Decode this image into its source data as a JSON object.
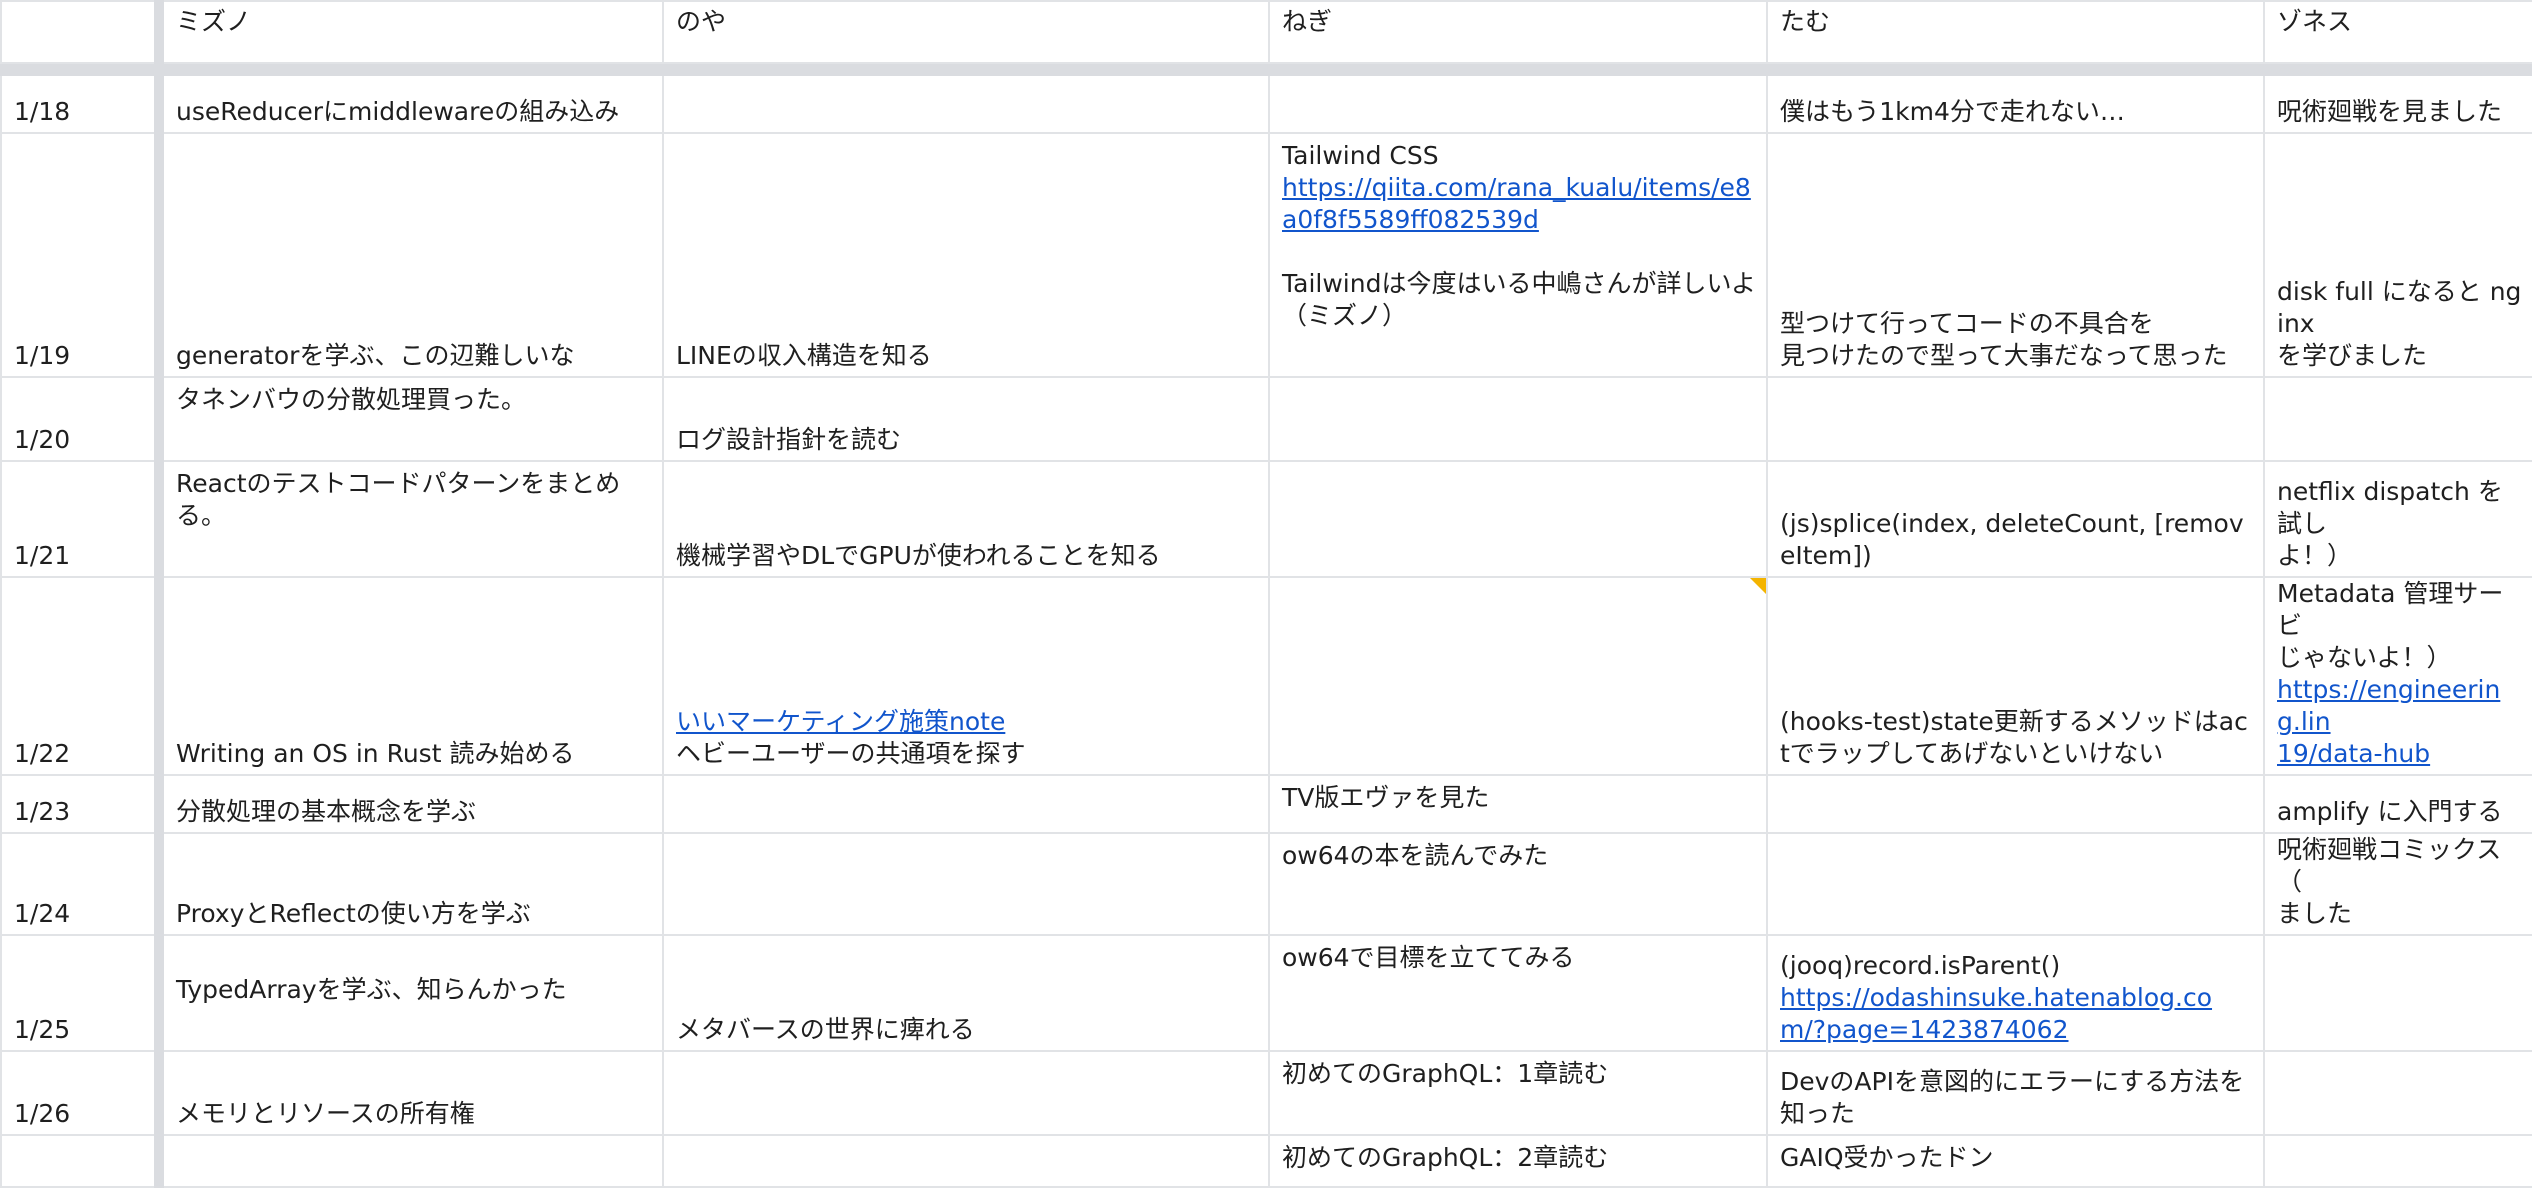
{
  "headers": [
    "",
    "ミズノ",
    "のや",
    "ねぎ",
    "たむ",
    "ゾネス"
  ],
  "rows": [
    {
      "date": "1/18",
      "cells": [
        {
          "lines": [
            {
              "t": "useReducerにmiddlewareの組み込み"
            }
          ]
        },
        {
          "lines": []
        },
        {
          "lines": []
        },
        {
          "lines": [
            {
              "t": "僕はもう1km4分で走れない…"
            }
          ]
        },
        {
          "lines": [
            {
              "t": "呪術廻戦を見ました"
            }
          ]
        }
      ]
    },
    {
      "date": "1/19",
      "cells": [
        {
          "lines": [
            {
              "t": "generatorを学ぶ、この辺難しいな"
            }
          ]
        },
        {
          "lines": [
            {
              "t": "LINEの収入構造を知る"
            }
          ]
        },
        {
          "top": true,
          "lines": [
            {
              "t": "Tailwind CSS"
            },
            {
              "t": "https://qiita.com/rana_kualu/items/e8a0f8f5589ff082539d",
              "link": true
            },
            {
              "t": " "
            },
            {
              "t": "Tailwindは今度はいる中嶋さんが詳しいよ（ミズノ）"
            }
          ]
        },
        {
          "lines": [
            {
              "t": "型つけて行ってコードの不具合を"
            },
            {
              "t": "見つけたので型って大事だなって思った"
            }
          ]
        },
        {
          "lines": [
            {
              "t": "disk full になると nginx"
            },
            {
              "t": "を学びました"
            }
          ]
        }
      ]
    },
    {
      "date": "1/20",
      "cells": [
        {
          "top": true,
          "lines": [
            {
              "t": "タネンバウの分散処理買った。"
            }
          ]
        },
        {
          "lines": [
            {
              "t": "ログ設計指針を読む"
            }
          ]
        },
        {
          "lines": []
        },
        {
          "lines": []
        },
        {
          "lines": []
        }
      ]
    },
    {
      "date": "1/21",
      "cells": [
        {
          "top": true,
          "lines": [
            {
              "t": "Reactのテストコードパターンをまとめる。"
            }
          ]
        },
        {
          "lines": [
            {
              "t": "機械学習やDLでGPUが使われることを知る"
            }
          ]
        },
        {
          "lines": []
        },
        {
          "lines": [
            {
              "t": "(js)splice(index, deleteCount, [removeItem])"
            }
          ]
        },
        {
          "lines": [
            {
              "t": "netflix dispatch を試し"
            },
            {
              "t": "よ！）"
            }
          ]
        }
      ]
    },
    {
      "date": "1/22",
      "cells": [
        {
          "lines": [
            {
              "t": "Writing an OS in Rust 読み始める"
            }
          ]
        },
        {
          "lines": [
            {
              "t": "いいマーケティング施策note",
              "link": true
            },
            {
              "t": "ヘビーユーザーの共通項を探す"
            }
          ]
        },
        {
          "lines": [],
          "flag": true
        },
        {
          "lines": [
            {
              "t": "(hooks-test)state更新するメソッドはactでラップしてあげないといけない"
            }
          ]
        },
        {
          "lines": [
            {
              "t": "Metadata 管理サービ"
            },
            {
              "t": "じゃないよ！）"
            },
            {
              "t": "https://engineering.lin",
              "link": true
            },
            {
              "t": "19/data-hub",
              "link": true
            }
          ]
        }
      ]
    },
    {
      "date": "1/23",
      "cells": [
        {
          "lines": [
            {
              "t": "分散処理の基本概念を学ぶ"
            }
          ]
        },
        {
          "lines": []
        },
        {
          "top": true,
          "lines": [
            {
              "t": "TV版エヴァを見た"
            }
          ]
        },
        {
          "lines": []
        },
        {
          "lines": [
            {
              "t": "amplify に入門する"
            }
          ]
        }
      ]
    },
    {
      "date": "1/24",
      "cells": [
        {
          "lines": [
            {
              "t": "ProxyとReflectの使い方を学ぶ"
            }
          ]
        },
        {
          "lines": []
        },
        {
          "top": true,
          "lines": [
            {
              "t": "ow64の本を読んでみた"
            }
          ]
        },
        {
          "lines": []
        },
        {
          "lines": [
            {
              "t": "呪術廻戦コミックス（"
            },
            {
              "t": "ました"
            }
          ]
        }
      ]
    },
    {
      "date": "1/25",
      "cells": [
        {
          "top": true,
          "lines": [
            {
              "t": " "
            },
            {
              "t": "TypedArrayを学ぶ、知らんかった"
            }
          ]
        },
        {
          "lines": [
            {
              "t": "メタバースの世界に痺れる"
            }
          ]
        },
        {
          "top": true,
          "lines": [
            {
              "t": "ow64で目標を立ててみる"
            }
          ]
        },
        {
          "lines": [
            {
              "t": "(jooq)record.isParent()"
            },
            {
              "t": "https://odashinsuke.hatenablog.com/?page=1423874062",
              "link": true
            }
          ]
        },
        {
          "lines": []
        }
      ]
    },
    {
      "date": "1/26",
      "cells": [
        {
          "lines": [
            {
              "t": "メモリとリソースの所有権"
            }
          ]
        },
        {
          "lines": []
        },
        {
          "top": true,
          "lines": [
            {
              "t": "初めてのGraphQL：1章読む"
            }
          ]
        },
        {
          "lines": [
            {
              "t": "DevのAPIを意図的にエラーにする方法を知った"
            }
          ]
        },
        {
          "lines": []
        }
      ]
    },
    {
      "date": "",
      "cells": [
        {
          "lines": []
        },
        {
          "lines": []
        },
        {
          "top": true,
          "lines": [
            {
              "t": "初めてのGraphQL：2章読む"
            }
          ]
        },
        {
          "top": true,
          "lines": [
            {
              "t": "GAIQ受かったドン"
            }
          ]
        },
        {
          "lines": []
        }
      ]
    }
  ]
}
